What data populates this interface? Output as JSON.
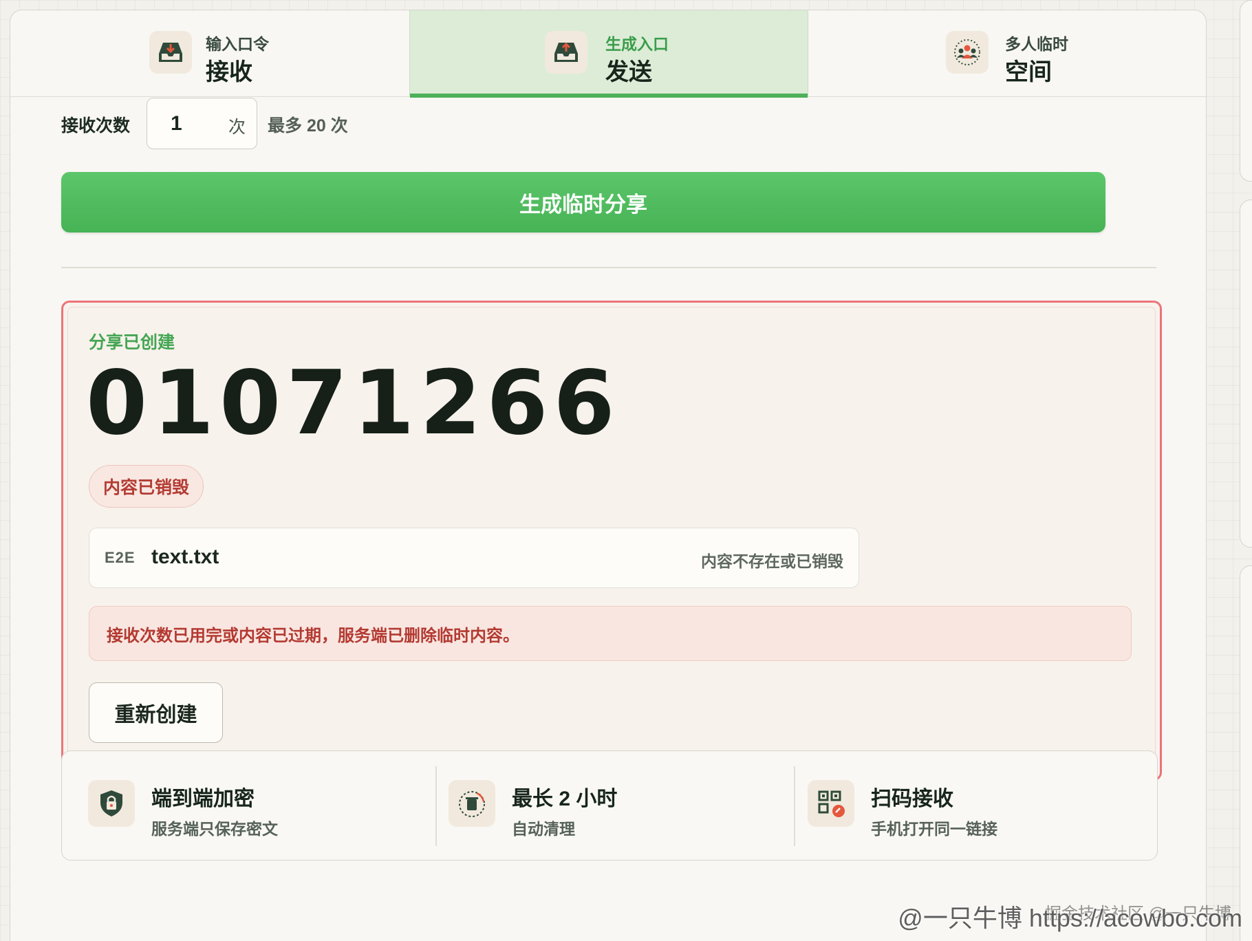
{
  "tabs": [
    {
      "small": "输入口令",
      "big": "接收",
      "icon": "inbox-download-icon"
    },
    {
      "small": "生成入口",
      "big": "发送",
      "icon": "inbox-upload-icon"
    },
    {
      "small": "多人临时",
      "big": "空间",
      "icon": "group-icon"
    }
  ],
  "active_tab": 1,
  "receive": {
    "label": "接收次数",
    "value": "1",
    "unit": "次",
    "max_label": "最多 20 次"
  },
  "generate_button": "生成临时分享",
  "result": {
    "status": "分享已创建",
    "code": "01071266",
    "badge": "内容已销毁",
    "file": {
      "tag": "E2E",
      "name": "text.txt",
      "status": "内容不存在或已销毁"
    },
    "alert": "接收次数已用完或内容已过期，服务端已删除临时内容。",
    "recreate_button": "重新创建"
  },
  "features": [
    {
      "title": "端到端加密",
      "sub": "服务端只保存密文",
      "icon": "shield-lock-icon"
    },
    {
      "title": "最长 2 小时",
      "sub": "自动清理",
      "icon": "trash-timer-icon"
    },
    {
      "title": "扫码接收",
      "sub": "手机打开同一链接",
      "icon": "qr-code-icon"
    }
  ],
  "watermark": "@一只牛博 https://acowbo.com",
  "watermark2": "掘金技术社区 @一只牛博",
  "colors": {
    "accent": "#4cb159",
    "danger": "#ec7378",
    "danger_text": "#b33a31"
  }
}
